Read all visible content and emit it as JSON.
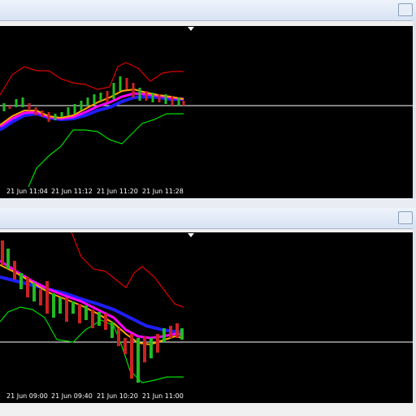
{
  "windows": [
    {
      "id": "top",
      "title": "",
      "time_axis": [
        "21 Jun 11:04",
        "21 Jun 11:12",
        "21 Jun 11:20",
        "21 Jun 11:28"
      ],
      "colors": {
        "upper_band": "#e00000",
        "lower_band": "#00dd00",
        "ma_fast": "#ffa500",
        "ma_mid": "#ff00ff",
        "ma_slow": "#1f1fff",
        "level_line": "#ffffff",
        "candle_up": "#22bb22",
        "candle_down": "#cc2222"
      }
    },
    {
      "id": "bottom",
      "title": "",
      "time_axis": [
        "21 Jun 09:00",
        "21 Jun 09:40",
        "21 Jun 10:20",
        "21 Jun 11:00"
      ],
      "colors": {
        "upper_band": "#e00000",
        "lower_band": "#00dd00",
        "ma_fast": "#ffa500",
        "ma_mid": "#ff00ff",
        "ma_slow": "#1f1fff",
        "level_line": "#ffffff",
        "candle_up": "#22bb22",
        "candle_down": "#cc2222"
      }
    }
  ]
}
